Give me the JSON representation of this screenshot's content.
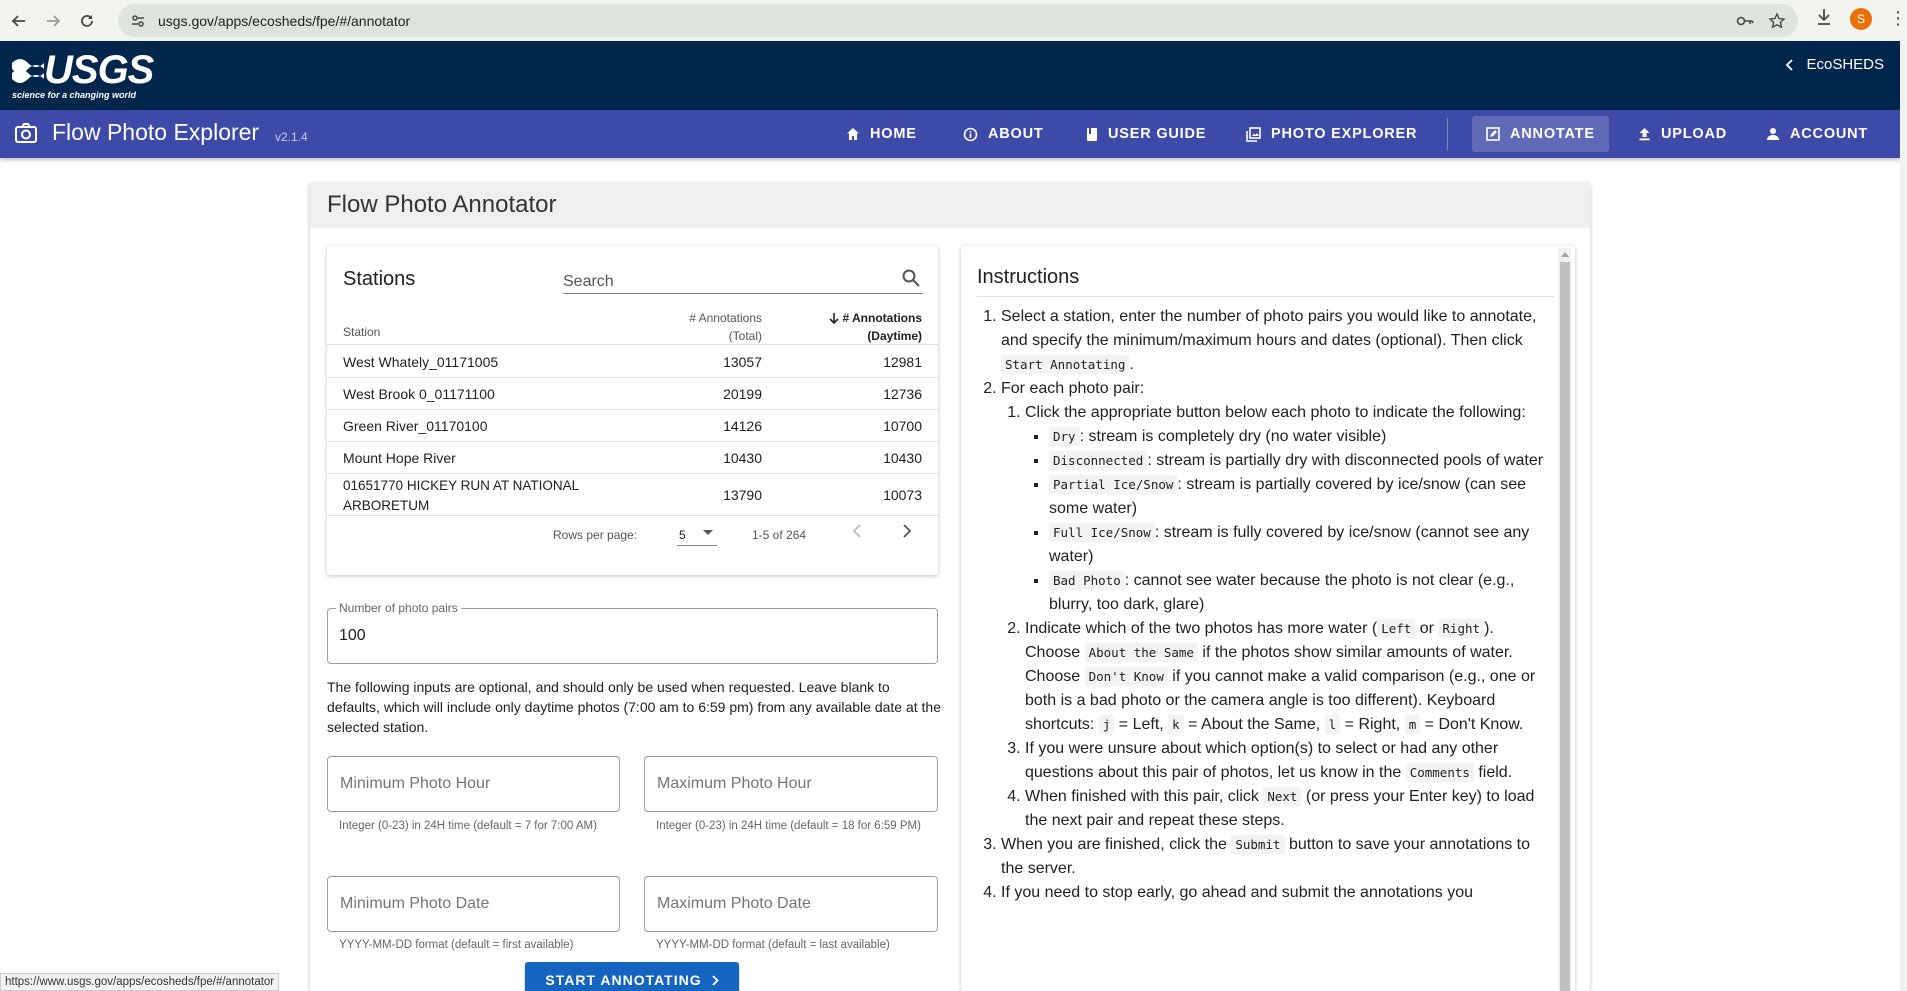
{
  "browser": {
    "url": "usgs.gov/apps/ecosheds/fpe/#/annotator",
    "profile_initial": "S",
    "status_url": "https://www.usgs.gov/apps/ecosheds/fpe/#/annotator"
  },
  "usgs": {
    "logo_text": "USGS",
    "tagline": "science for a changing world",
    "ecosheds_link": "EcoSHEDS"
  },
  "appbar": {
    "title": "Flow Photo Explorer",
    "version": "v2.1.4",
    "nav": [
      {
        "label": "HOME",
        "icon": "home-icon"
      },
      {
        "label": "ABOUT",
        "icon": "info-icon"
      },
      {
        "label": "USER GUIDE",
        "icon": "book-icon"
      },
      {
        "label": "PHOTO EXPLORER",
        "icon": "gallery-icon"
      },
      {
        "label": "ANNOTATE",
        "icon": "annotate-icon",
        "active": true
      },
      {
        "label": "UPLOAD",
        "icon": "upload-icon"
      },
      {
        "label": "ACCOUNT",
        "icon": "account-icon"
      }
    ]
  },
  "annotator": {
    "title": "Flow Photo Annotator",
    "stations": {
      "heading": "Stations",
      "search_placeholder": "Search",
      "columns": {
        "station": "Station",
        "total_line1": "# Annotations",
        "total_line2": "(Total)",
        "daytime_line1": "# Annotations",
        "daytime_line2": "(Daytime)"
      },
      "rows": [
        {
          "station": "West Whately_01171005",
          "total": "13057",
          "daytime": "12981"
        },
        {
          "station": "West Brook 0_01171100",
          "total": "20199",
          "daytime": "12736"
        },
        {
          "station": "Green River_01170100",
          "total": "14126",
          "daytime": "10700"
        },
        {
          "station": "Mount Hope River",
          "total": "10430",
          "daytime": "10430"
        },
        {
          "station_line1": "01651770 HICKEY RUN AT NATIONAL",
          "station_line2": "ARBORETUM",
          "total": "13790",
          "daytime": "10073"
        }
      ],
      "pager": {
        "rows_per_page_label": "Rows per page:",
        "rows_per_page": "5",
        "range": "1-5 of 264"
      }
    },
    "photo_pairs": {
      "label": "Number of photo pairs",
      "value": "100"
    },
    "optional_text": "The following inputs are optional, and should only be used when requested. Leave blank to defaults, which will include only daytime photos (7:00 am to 6:59 pm) from any available date at the selected station.",
    "min_hour": {
      "placeholder": "Minimum Photo Hour",
      "hint": "Integer (0-23) in 24H time (default = 7 for 7:00 AM)"
    },
    "max_hour": {
      "placeholder": "Maximum Photo Hour",
      "hint": "Integer (0-23) in 24H time (default = 18 for 6:59 PM)"
    },
    "min_date": {
      "placeholder": "Minimum Photo Date",
      "hint": "YYYY-MM-DD format (default = first available)"
    },
    "max_date": {
      "placeholder": "Maximum Photo Date",
      "hint": "YYYY-MM-DD format (default = last available)"
    },
    "start_button": "START ANNOTATING"
  },
  "instructions": {
    "heading": "Instructions",
    "s1_a": "Select a station, enter the number of photo pairs you would like to annotate, and specify the minimum/maximum hours and dates (optional). Then click",
    "s1_code": "Start Annotating",
    "s1_b": ".",
    "s2": "For each photo pair:",
    "s2_1": "Click the appropriate button below each photo to indicate the following:",
    "opt_dry_code": "Dry",
    "opt_dry_text": ": stream is completely dry (no water visible)",
    "opt_disc_code": "Disconnected",
    "opt_disc_text": ": stream is partially dry with disconnected pools of water",
    "opt_partial_code": "Partial Ice/Snow",
    "opt_partial_text": ": stream is partially covered by ice/snow (can see some water)",
    "opt_full_code": "Full Ice/Snow",
    "opt_full_text": ": stream is fully covered by ice/snow (cannot see any water)",
    "opt_bad_code": "Bad Photo",
    "opt_bad_text": ": cannot see water because the photo is not clear (e.g., blurry, too dark, glare)",
    "s2_2_a": "Indicate which of the two photos has more water (",
    "s2_2_left": "Left",
    "s2_2_or": " or ",
    "s2_2_right": "Right",
    "s2_2_b": "). Choose ",
    "s2_2_same": "About the Same",
    "s2_2_c": " if the photos show similar amounts of water. Choose ",
    "s2_2_dk": "Don't Know",
    "s2_2_d": " if you cannot make a valid comparison (e.g., one or both is a bad photo or the camera angle is too different). Keyboard shortcuts: ",
    "k_j": "j",
    "k_j_text": " = Left, ",
    "k_k": "k",
    "k_k_text": " = About the Same, ",
    "k_l": "l",
    "k_l_text": " = Right, ",
    "k_m": "m",
    "k_m_text": " = Don't Know.",
    "s2_3_a": "If you were unsure about which option(s) to select or had any other questions about this pair of photos, let us know in the ",
    "s2_3_code": "Comments",
    "s2_3_b": " field.",
    "s2_4_a": "When finished with this pair, click ",
    "s2_4_code": "Next",
    "s2_4_b": " (or press your Enter key) to load the next pair and repeat these steps.",
    "s3_a": "When you are finished, click the ",
    "s3_code": "Submit",
    "s3_b": " button to save your annotations to the server.",
    "s4": "If you need to stop early, go ahead and submit the annotations you"
  }
}
